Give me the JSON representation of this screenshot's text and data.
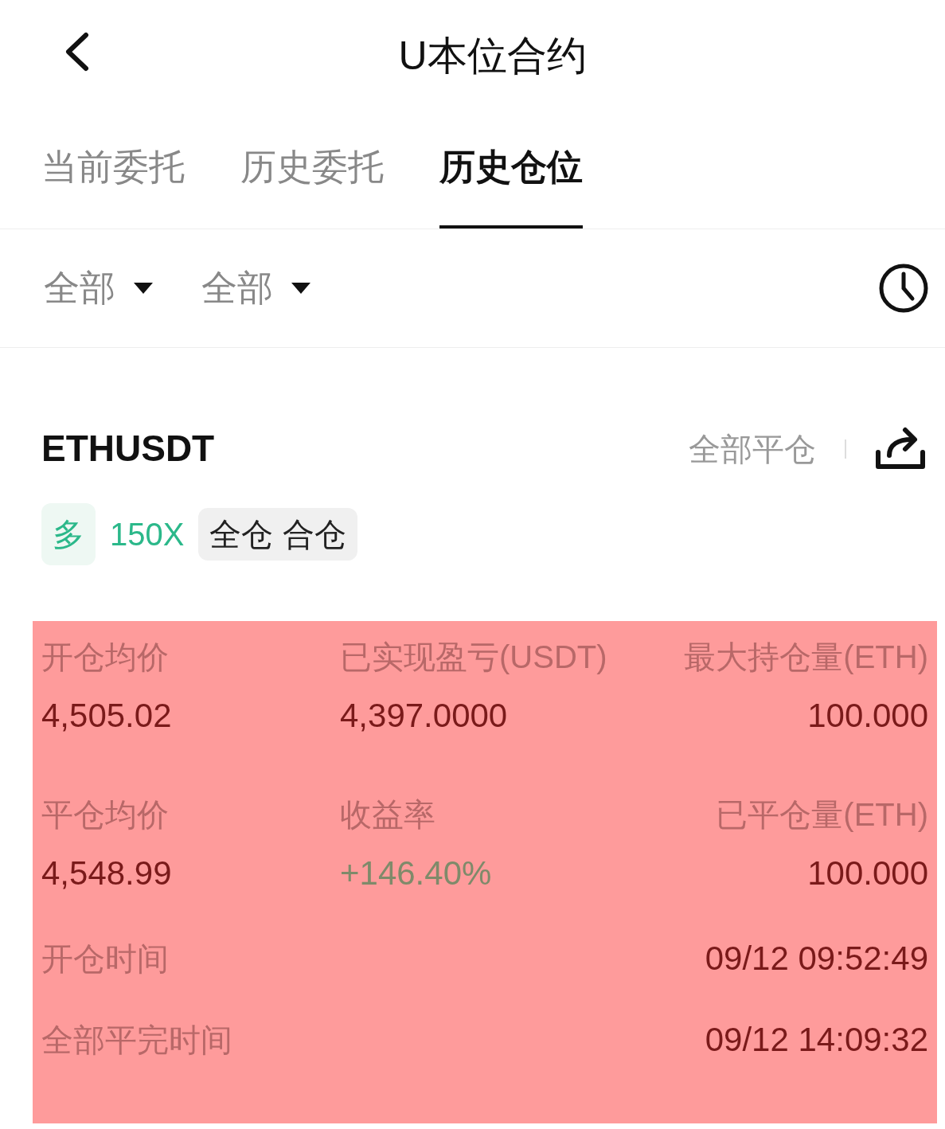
{
  "header": {
    "title": "U本位合约"
  },
  "tabs": [
    {
      "label": "当前委托",
      "selected": false
    },
    {
      "label": "历史委托",
      "selected": false
    },
    {
      "label": "历史仓位",
      "selected": true
    }
  ],
  "filters": [
    {
      "label": "全部"
    },
    {
      "label": "全部"
    }
  ],
  "position": {
    "symbol": "ETHUSDT",
    "close_all": "全部平仓",
    "tags": [
      {
        "kind": "side",
        "label": "多"
      },
      {
        "kind": "leverage",
        "label": "150X"
      },
      {
        "kind": "mode",
        "label": "全仓 合仓"
      }
    ],
    "stats": [
      {
        "label": "开仓均价",
        "value": "4,505.02",
        "kind": "plain"
      },
      {
        "label": "已实现盈亏(USDT)",
        "value": "4,397.0000",
        "kind": "plain"
      },
      {
        "label": "最大持仓量(ETH)",
        "value": "100.000",
        "kind": "plain"
      },
      {
        "label": "平仓均价",
        "value": "4,548.99",
        "kind": "plain"
      },
      {
        "label": "收益率",
        "value": "+146.40%",
        "kind": "profit"
      },
      {
        "label": "已平仓量(ETH)",
        "value": "100.000",
        "kind": "plain"
      }
    ],
    "times": [
      {
        "label": "开仓时间",
        "value": "09/12 09:52:49"
      },
      {
        "label": "全部平完时间",
        "value": "09/12 14:09:32"
      }
    ]
  }
}
